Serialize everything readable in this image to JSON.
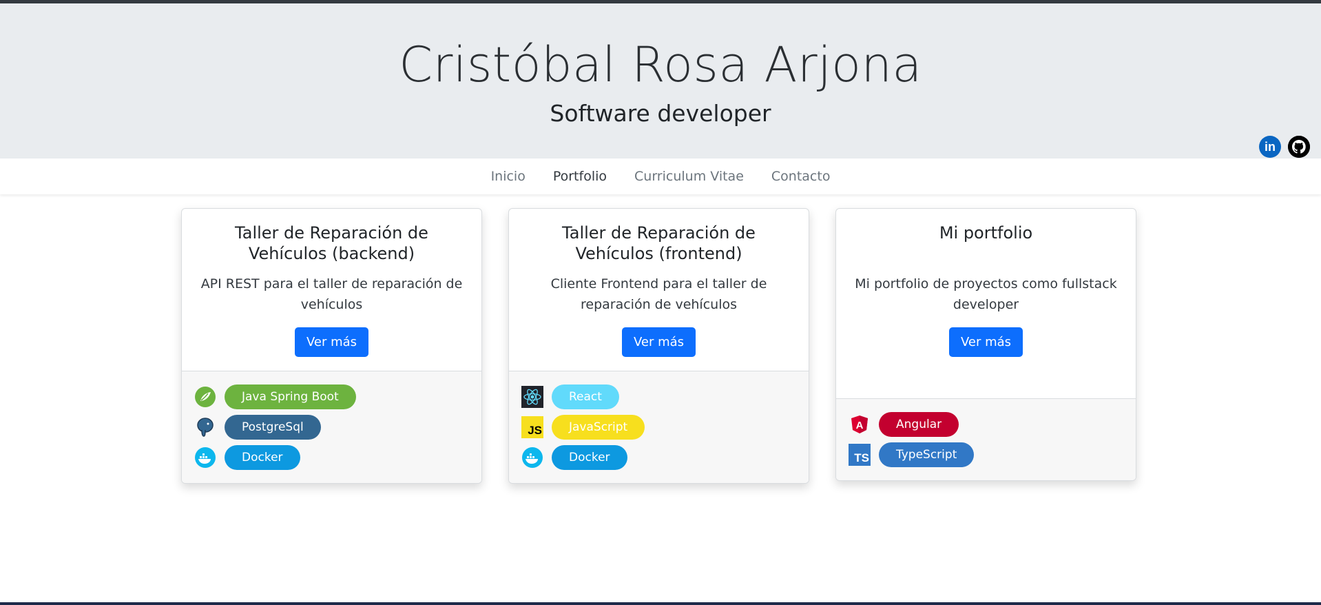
{
  "header": {
    "name": "Cristóbal Rosa Arjona",
    "role": "Software developer",
    "social": [
      {
        "icon": "linkedin-icon",
        "label": "in"
      },
      {
        "icon": "github-icon"
      }
    ]
  },
  "nav": {
    "items": [
      {
        "label": "Inicio",
        "active": false
      },
      {
        "label": "Portfolio",
        "active": true
      },
      {
        "label": "Curriculum Vitae",
        "active": false
      },
      {
        "label": "Contacto",
        "active": false
      }
    ]
  },
  "cards": [
    {
      "title": "Taller de Reparación de Vehículos (backend)",
      "description": "API REST para el taller de reparación de vehículos",
      "button": "Ver más",
      "tech": [
        {
          "label": "Java Spring Boot",
          "icon": "spring-icon",
          "color": "#6db33f"
        },
        {
          "label": "PostgreSql",
          "icon": "postgresql-icon",
          "color": "#336791"
        },
        {
          "label": "Docker",
          "icon": "docker-icon",
          "color": "#0db7ed"
        }
      ]
    },
    {
      "title": "Taller de Reparación de Vehículos (frontend)",
      "description": "Cliente Frontend para el taller de reparación de vehículos",
      "button": "Ver más",
      "tech": [
        {
          "label": "React",
          "icon": "react-icon",
          "color": "#61dafb"
        },
        {
          "label": "JavaScript",
          "icon": "javascript-icon",
          "color": "#f7df1e",
          "icon_text": "JS"
        },
        {
          "label": "Docker",
          "icon": "docker-icon",
          "color": "#0db7ed"
        }
      ]
    },
    {
      "title": "Mi portfolio",
      "description": "Mi portfolio de proyectos como fullstack developer",
      "button": "Ver más",
      "tech": [
        {
          "label": "Angular",
          "icon": "angular-icon",
          "color": "#c3002f",
          "icon_text": "A"
        },
        {
          "label": "TypeScript",
          "icon": "typescript-icon",
          "color": "#3178c6",
          "icon_text": "TS"
        }
      ]
    }
  ]
}
